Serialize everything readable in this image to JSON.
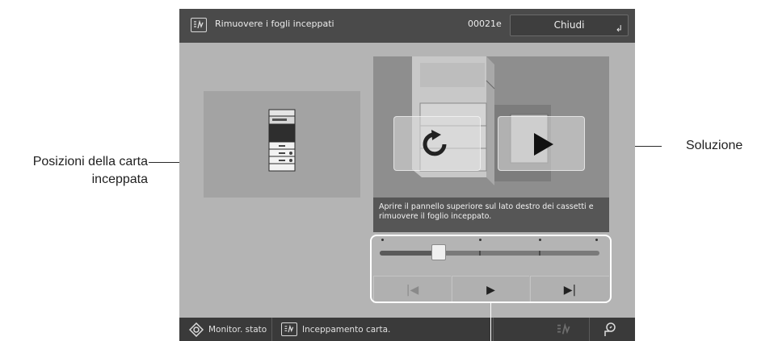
{
  "annotations": {
    "jam_position_line1": "Posizioni della carta",
    "jam_position_line2": "inceppata",
    "solution": "Soluzione"
  },
  "titlebar": {
    "icon": "paper-jam-icon",
    "title": "Rimuovere i fogli inceppati",
    "code": "00021e",
    "close_label": "Chiudi",
    "close_corner_glyph": "↲"
  },
  "jam_map": {
    "icon": "printer-icon"
  },
  "video": {
    "replay_icon": "replay-icon",
    "play_icon": "play-icon",
    "caption": "Aprire il pannello superiore sul lato destro dei cassetti e rimuovere il foglio inceppato."
  },
  "playback": {
    "position": 0.27,
    "step_markers": 4,
    "buttons": [
      {
        "name": "skip-back",
        "glyph": "|◀",
        "enabled": false
      },
      {
        "name": "play",
        "glyph": "▶",
        "enabled": true
      },
      {
        "name": "skip-forward",
        "glyph": "▶|",
        "enabled": true
      }
    ]
  },
  "statusbar": {
    "monitor_label": "Monitor. stato",
    "jam_label": "Inceppamento carta.",
    "monitor_icon": "status-monitor-icon",
    "jam_icon": "paper-jam-icon",
    "dim_icon": "paper-jam-icon",
    "settings_icon": "account-icon"
  },
  "colors": {
    "screen_bg": "#b4b4b4",
    "titlebar_bg": "#4a4a4a",
    "statusbar_bg": "#3a3a3a",
    "caption_bg": "#565656"
  }
}
